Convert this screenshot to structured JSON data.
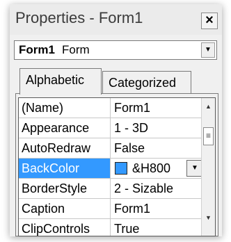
{
  "window": {
    "title": "Properties - Form1",
    "close_label": "×"
  },
  "object_select": {
    "name": "Form1",
    "type": "Form"
  },
  "tabs": [
    {
      "label": "Alphabetic",
      "active": true
    },
    {
      "label": "Categorized",
      "active": false
    }
  ],
  "properties": [
    {
      "name": "(Name)",
      "value": "Form1"
    },
    {
      "name": "Appearance",
      "value": "1 - 3D"
    },
    {
      "name": "AutoRedraw",
      "value": "False"
    },
    {
      "name": "BackColor",
      "value": "&H800",
      "selected": true
    },
    {
      "name": "BorderStyle",
      "value": "2 - Sizable"
    },
    {
      "name": "Caption",
      "value": "Form1"
    },
    {
      "name": "ClipControls",
      "value": "True"
    }
  ],
  "colors": {
    "selection": "#3399ff",
    "backcolor_swatch": "#3399ff"
  },
  "icons": {
    "dropdown": "▼",
    "scroll_up": "▲",
    "scroll_down": "▼",
    "scroll_grip": "≡"
  }
}
